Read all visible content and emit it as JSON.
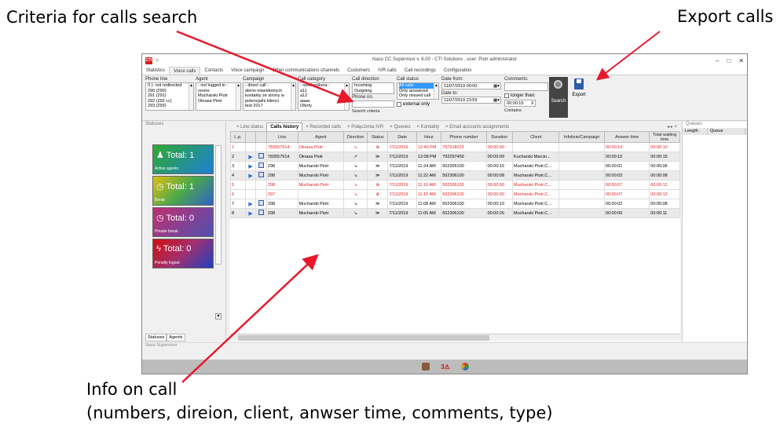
{
  "annotations": {
    "criteria": "Criteria for calls search",
    "export": "Export calls",
    "info_line1": "Info on call",
    "info_line2": "(numbers, direion, client, anwser time, comments, type)"
  },
  "window": {
    "logo": "CTI",
    "title": "Naso CC Supervisor  v. 6.00 - CTI Solutions ,  user: Piotr administrator",
    "controls": [
      "–",
      "□",
      "✕"
    ]
  },
  "menu": [
    "Statistics",
    "Voice calls",
    "Contacts",
    "Voice campaign",
    "Other communications channels",
    "Customers",
    "IVR calls",
    "Call recordings",
    "Configuration"
  ],
  "ribbon": {
    "phone_line": {
      "label": "Phone line",
      "items": [
        "0 (- not redirected",
        "290 (290)",
        "291 (291)",
        "292 (292 cc)",
        "293 (293)"
      ]
    },
    "agent": {
      "label": "Agent",
      "items": [
        "- not logged in -",
        "rerere",
        "Mucharski Piotr",
        "Okrasa Piotr"
      ]
    },
    "campaign": {
      "label": "Campaign",
      "items": [
        "- direct call -",
        "demo niewidomych",
        "kontakty ze strony w",
        "potencjalni klienci",
        "test 2017"
      ]
    },
    "category": {
      "label": "Call category",
      "items": [
        "- nieokreślona -",
        "a11",
        "a12",
        "aaaa",
        "Oferty"
      ]
    },
    "direction": {
      "label": "Call direction",
      "items": [
        "Incoming",
        "Outgoing"
      ]
    },
    "phone_no": {
      "label": "Phone no."
    },
    "search_criteria": "Search criteria",
    "status": {
      "label": "Call status",
      "items": [
        "All calls",
        "Only answered",
        "Only missed call"
      ],
      "external": "external only"
    },
    "date_from": {
      "label": "Date from:",
      "value": "11/07/2019  00:00"
    },
    "date_to": {
      "label": "Date to:",
      "value": "11/07/2019  23:59"
    },
    "comments": {
      "label": "Comments:"
    },
    "longer_than": {
      "label": "longer than:",
      "value": "00:00:15"
    },
    "contains": "Contains",
    "search_btn": "Search",
    "export_btn": "Export"
  },
  "statuses": {
    "header": "Statuses",
    "tiles": [
      {
        "value": "Total: 1",
        "label": "Active agents"
      },
      {
        "value": "Total: 1",
        "label": "Break"
      },
      {
        "value": "Total: 0",
        "label": "Private break"
      },
      {
        "value": "Total: 0",
        "label": "Penalty logout"
      }
    ],
    "tabs": [
      "Statuses",
      "Agents"
    ]
  },
  "center_tabs": [
    "Line status",
    "Calls history",
    "Recorded calls",
    "Połączenia IVR",
    "Queues",
    "Kontakty",
    "Email accounts assignments"
  ],
  "table": {
    "headers": [
      "L.p.",
      "",
      "",
      "Line",
      "Agent",
      "Direction",
      "Status",
      "Date",
      "Hour",
      "Phone number",
      "Duration",
      "Client",
      "Infolinie/Campaign",
      "Answer time",
      "Total waiting time"
    ],
    "rows": [
      {
        "lp": "1",
        "play": false,
        "line": "783557914",
        "agent": "Okrasa Piotr",
        "dir": "↘",
        "status": "⊗",
        "date": "7/11/2019",
        "hour": "12:40 PM",
        "phone": "797318223",
        "dur": "00:00:00",
        "client": "",
        "camp": "",
        "ans": "00:00:10",
        "wait": "00:00:10",
        "red": true
      },
      {
        "lp": "2",
        "play": true,
        "line": "783557914",
        "agent": "Okrasa Piotr",
        "dir": "↗",
        "status": "≫",
        "date": "7/11/2019",
        "hour": "12:08 PM",
        "phone": "792297459",
        "dur": "00:00:09",
        "client": "Kucharski Marcin...",
        "camp": "",
        "ans": "00:00:15",
        "wait": "00:00:15",
        "red": false
      },
      {
        "lp": "3",
        "play": true,
        "line": "298",
        "agent": "Mucharski Piotr",
        "dir": "↘",
        "status": "≫",
        "date": "7/11/2019",
        "hour": "11:24 AM",
        "phone": "502306100",
        "dur": "00:00:15",
        "client": "Mucharski Piotr;C...",
        "camp": "",
        "ans": "00:00:01",
        "wait": "00:00:06",
        "red": false
      },
      {
        "lp": "4",
        "play": true,
        "line": "298",
        "agent": "Mucharski Piotr",
        "dir": "↘",
        "status": "≫",
        "date": "7/11/2019",
        "hour": "11:22 AM",
        "phone": "502306100",
        "dur": "00:00:08",
        "client": "Mucharski Piotr;C...",
        "camp": "",
        "ans": "00:00:02",
        "wait": "00:00:08",
        "red": false
      },
      {
        "lp": "5",
        "play": false,
        "line": "298",
        "agent": "Mucharski Piotr",
        "dir": "↘",
        "status": "⊗",
        "date": "7/11/2019",
        "hour": "11:10 AM",
        "phone": "502306100",
        "dur": "00:00:00",
        "client": "Mucharski Piotr;C...",
        "camp": "",
        "ans": "00:00:07",
        "wait": "00:00:12",
        "red": true
      },
      {
        "lp": "6",
        "play": false,
        "line": "297",
        "agent": "",
        "dir": "↘",
        "status": "⊗",
        "date": "7/11/2019",
        "hour": "11:10 AM",
        "phone": "502306100",
        "dur": "00:00:00",
        "client": "Mucharski Piotr;C...",
        "camp": "",
        "ans": "00:00:07",
        "wait": "00:00:12",
        "red": true
      },
      {
        "lp": "7",
        "play": true,
        "line": "298",
        "agent": "Mucharski Piotr",
        "dir": "↘",
        "status": "≫",
        "date": "7/11/2019",
        "hour": "11:08 AM",
        "phone": "502306100",
        "dur": "00:00:10",
        "client": "Mucharski Piotr;C...",
        "camp": "",
        "ans": "00:00:02",
        "wait": "00:00:08",
        "red": false
      },
      {
        "lp": "8",
        "play": true,
        "line": "298",
        "agent": "Mucharski Piotr",
        "dir": "↘",
        "status": "≫",
        "date": "7/11/2019",
        "hour": "11:05 AM",
        "phone": "502306100",
        "dur": "00:00:26",
        "client": "Mucharski Piotr;C...",
        "camp": "",
        "ans": "00:00:06",
        "wait": "00:00:11",
        "red": false
      }
    ]
  },
  "queues": {
    "header": "Queues",
    "columns": [
      "Length",
      "Queue"
    ]
  },
  "bottom_pane": "Naso Supervisor",
  "colors": {
    "arrow": "#e8182c",
    "missed": "#e02020",
    "accent": "#2a6fd0"
  }
}
